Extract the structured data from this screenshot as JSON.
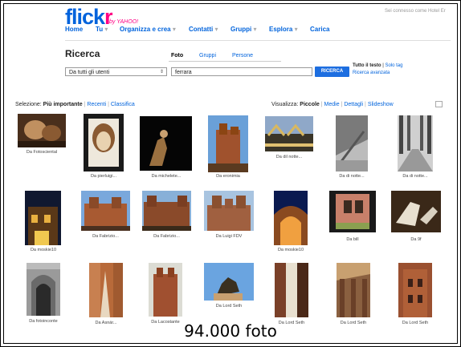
{
  "header": {
    "logo": "flickr",
    "logo_flick": "flick",
    "logo_r": "r",
    "yahoo": "by YAHOO!",
    "signed_in": "Sei connesso come Hotel Er"
  },
  "nav": [
    {
      "label": "Home"
    },
    {
      "label": "Tu"
    },
    {
      "label": "Organizza e crea"
    },
    {
      "label": "Contatti"
    },
    {
      "label": "Gruppi"
    },
    {
      "label": "Esplora"
    },
    {
      "label": "Carica"
    }
  ],
  "search": {
    "title": "Ricerca",
    "tabs": [
      "Foto",
      "Gruppi",
      "Persone"
    ],
    "scope": "Da tutti gli utenti",
    "query": "ferrara",
    "button": "RICERCA",
    "full_text": "Tutto il testo",
    "tags_only": "Solo tag",
    "advanced": "Ricerca avanzata"
  },
  "selection": {
    "label": "Selezione:",
    "options": [
      "Più importante",
      "Recenti",
      "Classifica"
    ]
  },
  "view": {
    "label": "Visualizza:",
    "options": [
      "Piccole",
      "Medie",
      "Dettagli",
      "Slideshow"
    ]
  },
  "photos": [
    {
      "caption": "Da Fotosciental"
    },
    {
      "caption": "Da pierluigi..."
    },
    {
      "caption": "Da michelete..."
    },
    {
      "caption": "Da eronimia"
    },
    {
      "caption": "Da dil notte..."
    },
    {
      "caption": "Da di notte..."
    },
    {
      "caption": "Da di notte..."
    },
    {
      "caption": "Da moskie10"
    },
    {
      "caption": "Da Fabrizio..."
    },
    {
      "caption": "Da Fabrizio..."
    },
    {
      "caption": "Da Luigi FDV"
    },
    {
      "caption": "Da moskie10"
    },
    {
      "caption": "Da bill"
    },
    {
      "caption": "Da 9f"
    },
    {
      "caption": "Da fotoinconte"
    },
    {
      "caption": "Da Asnár..."
    },
    {
      "caption": "Da Lacostante"
    },
    {
      "caption": "Da Lord Seth"
    },
    {
      "caption": "Da Lord Seth"
    },
    {
      "caption": "Da Lord Seth"
    },
    {
      "caption": "Da Lord Seth"
    }
  ],
  "footer": "94.000 foto",
  "colors": {
    "brand_blue": "#0063dc",
    "brand_pink": "#ff0084",
    "button": "#1d6ee0"
  }
}
